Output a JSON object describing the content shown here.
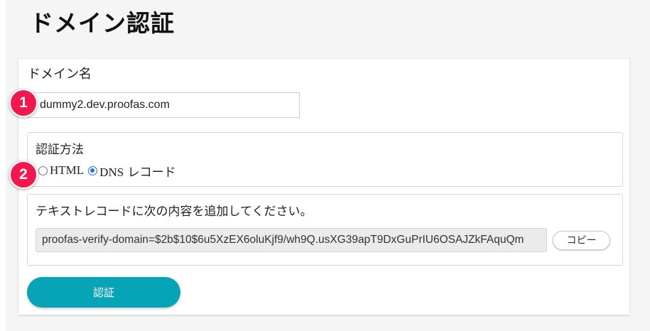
{
  "page": {
    "title": "ドメイン認証"
  },
  "domain": {
    "label": "ドメイン名",
    "value": "dummy2.dev.proofas.com"
  },
  "method": {
    "label": "認証方法",
    "options": [
      {
        "label": "HTML",
        "selected": false
      },
      {
        "label_latin": "DNS",
        "label_jp": " レコード",
        "selected": true
      }
    ]
  },
  "record": {
    "instruction": "テキストレコードに次の内容を追加してください。",
    "value": "proofas-verify-domain=$2b$10$6u5XzEX6oluKjf9/wh9Q.usXG39apT9DxGuPrIU6OSAJZkFAquQm",
    "copy_label": "コピー"
  },
  "actions": {
    "verify_label": "認証"
  },
  "annotations": {
    "badge_1": "1",
    "badge_2": "2"
  },
  "colors": {
    "accent": "#07a3b7",
    "badge": "#f0184f",
    "radio_selected": "#1a73e8"
  }
}
